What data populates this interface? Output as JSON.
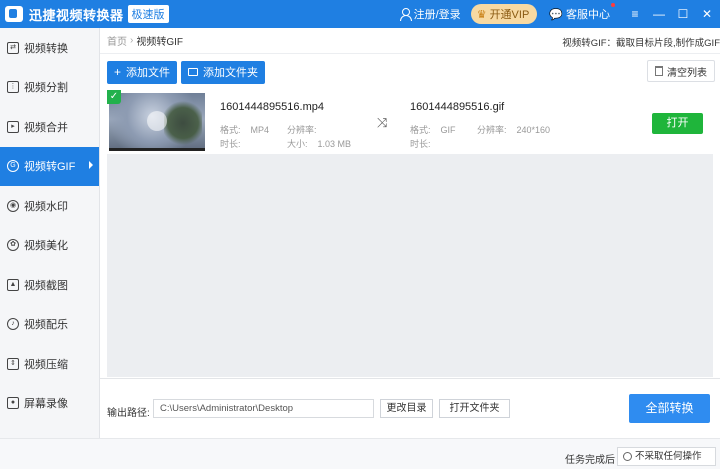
{
  "titlebar": {
    "app_title": "迅捷视频转换器",
    "edition": "极速版",
    "login": "注册/登录",
    "vip": "开通VIP",
    "service": "客服中心",
    "controls": [
      "—",
      "☐",
      "✕"
    ],
    "menu_icon": "≡"
  },
  "sidebar": {
    "items": [
      {
        "label": "视频转换",
        "icon": "video-convert-icon",
        "active": false
      },
      {
        "label": "视频分割",
        "icon": "video-split-icon",
        "active": false
      },
      {
        "label": "视频合并",
        "icon": "video-merge-icon",
        "active": false
      },
      {
        "label": "视频转GIF",
        "icon": "gif-icon",
        "active": true
      },
      {
        "label": "视频水印",
        "icon": "watermark-icon",
        "active": false
      },
      {
        "label": "视频美化",
        "icon": "beautify-icon",
        "active": false
      },
      {
        "label": "视频截图",
        "icon": "screenshot-icon",
        "active": false
      },
      {
        "label": "视频配乐",
        "icon": "music-icon",
        "active": false
      },
      {
        "label": "视频压缩",
        "icon": "compress-icon",
        "active": false
      },
      {
        "label": "屏幕录像",
        "icon": "record-icon",
        "active": false
      }
    ]
  },
  "main": {
    "breadcrumb": {
      "home": "首页",
      "separator": "›",
      "current": "视频转GIF"
    },
    "hint": "视频转GIF：截取目标片段,制作成GIF",
    "toolbar": {
      "add_file": "添加文件",
      "add_folder": "添加文件夹",
      "clear": "清空列表"
    },
    "files": [
      {
        "source": {
          "name": "1601444895516.mp4",
          "format_label": "格式:",
          "format": "MP4",
          "resolution_label": "分辨率:",
          "resolution": "",
          "duration_label": "时长:",
          "duration": "",
          "size_label": "大小:",
          "size": "1.03 MB"
        },
        "target": {
          "name": "1601444895516.gif",
          "format_label": "格式:",
          "format": "GIF",
          "resolution_label": "分辨率:",
          "resolution": "240*160",
          "duration_label": "时长:",
          "duration": ""
        },
        "open_label": "打开",
        "checked": true
      }
    ],
    "output": {
      "label": "输出路径:",
      "path": "C:\\Users\\Administrator\\Desktop",
      "change_dir": "更改目录",
      "open_folder": "打开文件夹",
      "convert_all": "全部转换"
    }
  },
  "statusbar": {
    "after_label": "任务完成后",
    "after_value": "不采取任何操作"
  },
  "colors": {
    "accent": "#1f7fe2",
    "open_button": "#1fb53b",
    "vip": "#f7d9a2",
    "check": "#22b14c"
  }
}
